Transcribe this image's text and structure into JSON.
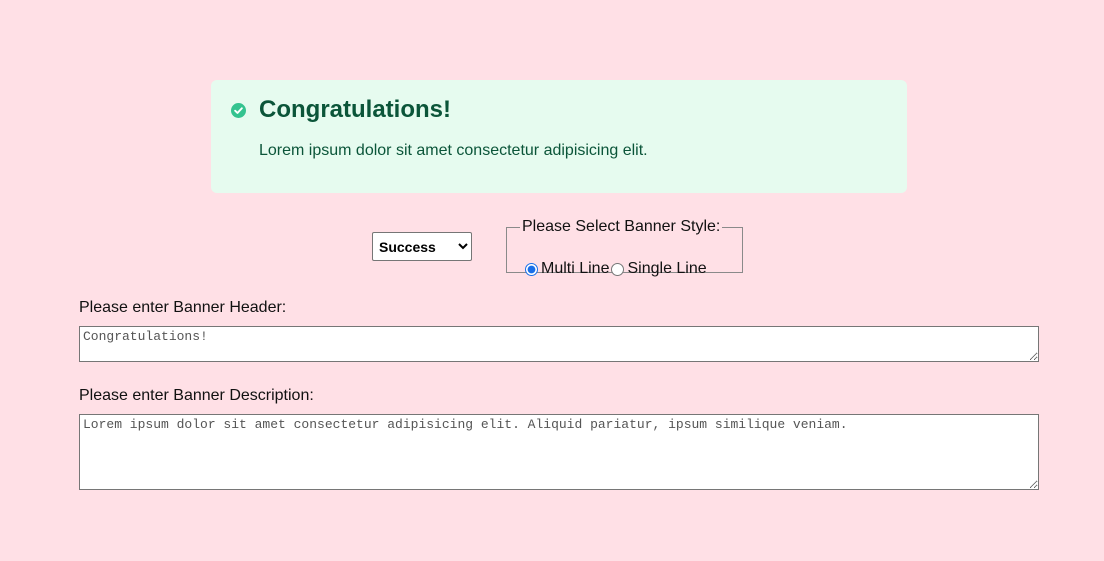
{
  "banner": {
    "title": "Congratulations!",
    "description": "Lorem ipsum dolor sit amet consectetur adipisicing elit.",
    "icon": "check-circle-icon",
    "accent_color": "#34c38f",
    "text_color": "#0b5539",
    "background_color": "#e6fbef"
  },
  "controls": {
    "type_select": {
      "selected": "Success"
    },
    "style_fieldset": {
      "legend": "Please Select Banner Style:",
      "options": [
        {
          "label": "Multi Line",
          "checked": true
        },
        {
          "label": "Single Line",
          "checked": false
        }
      ]
    }
  },
  "form": {
    "header_label": "Please enter Banner Header:",
    "header_placeholder": "Congratulations!",
    "description_label": "Please enter Banner Description:",
    "description_placeholder": "Lorem ipsum dolor sit amet consectetur adipisicing elit. Aliquid pariatur, ipsum similique veniam."
  },
  "page": {
    "background_color": "#ffe0e6"
  }
}
